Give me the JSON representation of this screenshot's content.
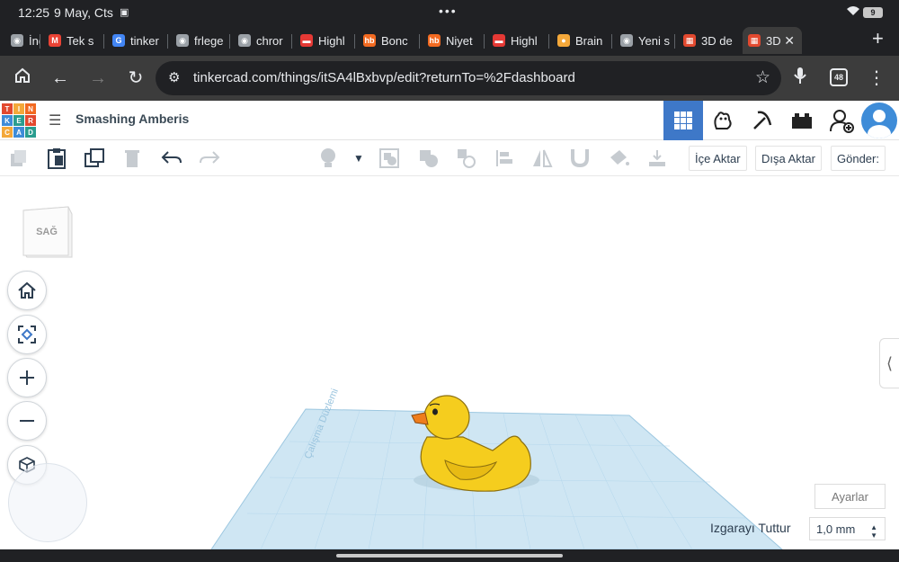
{
  "status_bar": {
    "time": "12:25",
    "date": "9 May, Cts",
    "more": "•••",
    "battery": "9"
  },
  "browser_tabs": [
    {
      "label": "İndiri",
      "icon": "chrome-globe-icon",
      "color": "#9aa0a6"
    },
    {
      "label": "Tek s",
      "icon": "gmail-icon",
      "color": "#ea4335"
    },
    {
      "label": "tinker",
      "icon": "google-icon",
      "color": "#4285f4"
    },
    {
      "label": "frlege",
      "icon": "chrome-globe-icon",
      "color": "#9aa0a6"
    },
    {
      "label": "chror",
      "icon": "chrome-globe-icon",
      "color": "#9aa0a6"
    },
    {
      "label": "Highl",
      "icon": "highlights-icon",
      "color": "#e53935"
    },
    {
      "label": "Bonc",
      "icon": "hb-icon",
      "color": "#f26a21"
    },
    {
      "label": "Niyet",
      "icon": "hb-icon",
      "color": "#f26a21"
    },
    {
      "label": "Highl",
      "icon": "highlights-icon",
      "color": "#e53935"
    },
    {
      "label": "Brain",
      "icon": "brain-icon",
      "color": "#f4a83a"
    },
    {
      "label": "Yeni s",
      "icon": "chrome-globe-icon",
      "color": "#9aa0a6"
    },
    {
      "label": "3D de",
      "icon": "tinkercad-icon",
      "color": "#e2492f"
    },
    {
      "label": "3D",
      "icon": "tinkercad-icon",
      "color": "#e2492f"
    }
  ],
  "address_bar": {
    "url": "tinkercad.com/things/itSA4lBxbvp/edit?returnTo=%2Fdashboard",
    "tab_count": "48"
  },
  "tinkercad": {
    "logo_letters": [
      "T",
      "I",
      "N",
      "K",
      "E",
      "R",
      "C",
      "A",
      "D"
    ],
    "logo_colors": [
      "#e2492f",
      "#f4a83a",
      "#f26a21",
      "#3e8cd8",
      "#2a9d8f",
      "#e2492f",
      "#f4a83a",
      "#3e8cd8",
      "#2a9d8f"
    ],
    "project_title": "Smashing Amberis",
    "edit_buttons": {
      "import": "İçe Aktar",
      "export": "Dışa Aktar",
      "send": "Gönder:"
    },
    "viewcube_face": "SAĞ",
    "workplane_label": "Çalışma Düzlemi",
    "settings": "Ayarlar",
    "snap_grid_label": "Izgarayı Tuttur",
    "snap_grid_value": "1,0 mm",
    "duck_colors": {
      "body": "#f5cd1e",
      "beak": "#ef7d1c",
      "outline": "#8b6f10",
      "plane": "#cfe6f3"
    }
  }
}
